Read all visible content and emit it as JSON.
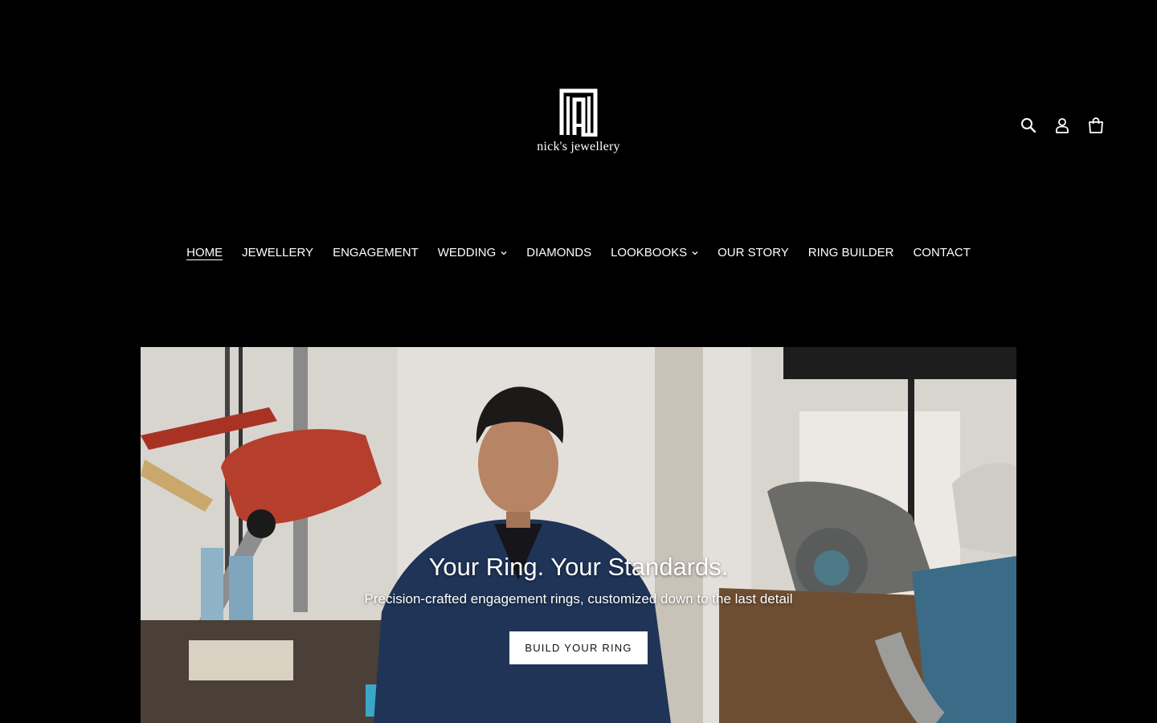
{
  "brand": {
    "name": "nick's jewellery",
    "logo_icon": "key-glyph-logo-icon"
  },
  "header_icons": {
    "search": "search-icon",
    "account": "account-icon",
    "cart": "cart-icon"
  },
  "nav": {
    "items": [
      {
        "label": "HOME",
        "active": true
      },
      {
        "label": "JEWELLERY"
      },
      {
        "label": "ENGAGEMENT"
      },
      {
        "label": "WEDDING",
        "dropdown": true
      },
      {
        "label": "DIAMONDS"
      },
      {
        "label": "LOOKBOOKS",
        "dropdown": true
      },
      {
        "label": "OUR STORY"
      },
      {
        "label": "RING BUILDER"
      },
      {
        "label": "CONTACT"
      }
    ]
  },
  "hero": {
    "title": "Your Ring. Your Standards.",
    "subtitle": "Precision-crafted engagement rings, customized down to the last detail",
    "button_label": "BUILD YOUR RING"
  },
  "colors": {
    "background": "#000000",
    "text": "#ffffff",
    "button_bg": "#ffffff",
    "button_text": "#111111"
  }
}
